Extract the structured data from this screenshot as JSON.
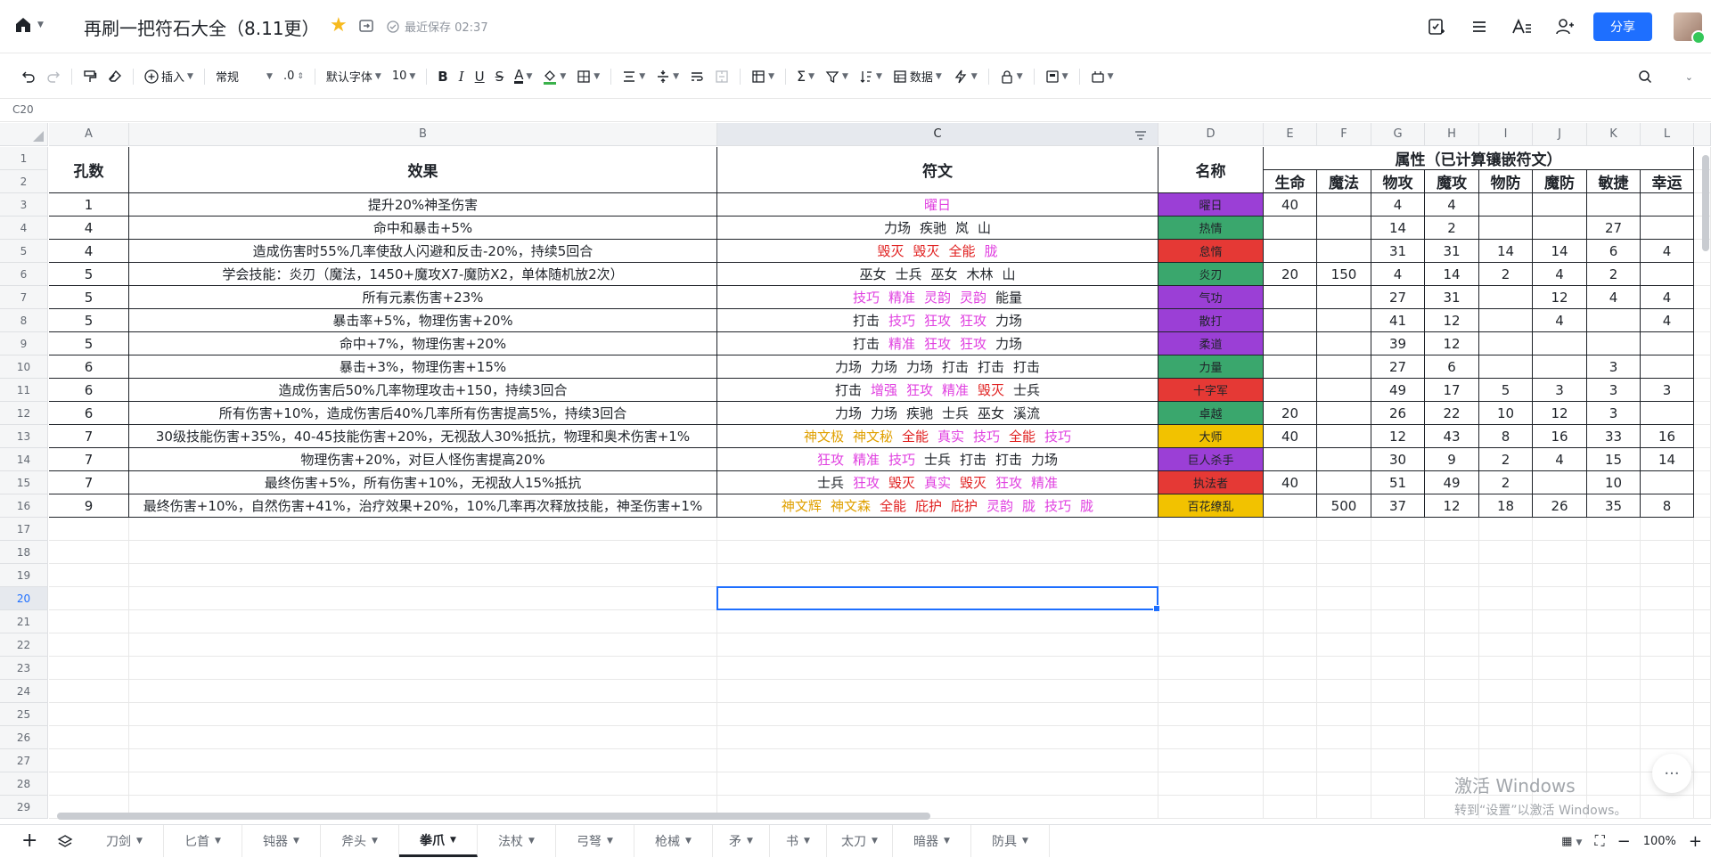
{
  "app": {
    "title": "再刷一把符石大全（8.11更）",
    "save_status": "最近保存 02:37",
    "share_label": "分享"
  },
  "toolbar": {
    "insert_label": "插入",
    "format_label": "常规",
    "decimal_label": ".0",
    "font_label": "默认字体",
    "size_label": "10",
    "data_label": "数据",
    "text_color": "#1f2329",
    "fill_color": "#3ab14b"
  },
  "cell_ref": "C20",
  "columns": [
    "A",
    "B",
    "C",
    "D",
    "E",
    "F",
    "G",
    "H",
    "I",
    "J",
    "K",
    "L"
  ],
  "row_numbers": [
    "1",
    "2",
    "3",
    "4",
    "5",
    "6",
    "7",
    "8",
    "9",
    "10",
    "11",
    "12",
    "13",
    "14",
    "15",
    "16",
    "17",
    "18",
    "19",
    "20",
    "21",
    "22",
    "23",
    "24",
    "25",
    "26",
    "27",
    "28",
    "29"
  ],
  "headers": {
    "holes": "孔数",
    "effect": "效果",
    "runes": "符文",
    "name": "名称",
    "attrs_group": "属性（已计算镶嵌符文）",
    "attrs": [
      "生命",
      "魔法",
      "物攻",
      "魔攻",
      "物防",
      "魔防",
      "敏捷",
      "幸运"
    ]
  },
  "colors": {
    "magenta": "#e040e0",
    "red": "#e02020",
    "gold": "#e0a000",
    "black": "#1f2329",
    "purple": "#9b3fd6",
    "green": "#3aa76d",
    "redfill": "#e53935",
    "yellow": "#f2c200"
  },
  "rows": [
    {
      "holes": "1",
      "effect": "提升20%神圣伤害",
      "runes": [
        {
          "t": "曜日",
          "c": "magenta"
        }
      ],
      "name": "曜日",
      "fill": "purple",
      "stats": [
        "40",
        "",
        "4",
        "4",
        "",
        "",
        "",
        ""
      ]
    },
    {
      "holes": "4",
      "effect": "命中和暴击+5%",
      "runes": [
        {
          "t": "力场",
          "c": "black"
        },
        {
          "t": "疾驰",
          "c": "black"
        },
        {
          "t": "岚",
          "c": "black"
        },
        {
          "t": "山",
          "c": "black"
        }
      ],
      "name": "热情",
      "fill": "green",
      "stats": [
        "",
        "",
        "14",
        "2",
        "",
        "",
        "27",
        ""
      ]
    },
    {
      "holes": "4",
      "effect": "造成伤害时55%几率使敌人闪避和反击-20%，持续5回合",
      "runes": [
        {
          "t": "毁灭",
          "c": "red"
        },
        {
          "t": "毁灭",
          "c": "red"
        },
        {
          "t": "全能",
          "c": "red"
        },
        {
          "t": "胧",
          "c": "magenta"
        }
      ],
      "name": "怠惰",
      "fill": "redfill",
      "stats": [
        "",
        "",
        "31",
        "31",
        "14",
        "14",
        "6",
        "4"
      ]
    },
    {
      "holes": "5",
      "effect": "学会技能：炎刃（魔法，1450+魔攻X7-魔防X2，单体随机放2次）",
      "runes": [
        {
          "t": "巫女",
          "c": "black"
        },
        {
          "t": "士兵",
          "c": "black"
        },
        {
          "t": "巫女",
          "c": "black"
        },
        {
          "t": "木林",
          "c": "black"
        },
        {
          "t": "山",
          "c": "black"
        }
      ],
      "name": "炎刃",
      "fill": "green",
      "stats": [
        "20",
        "150",
        "4",
        "14",
        "2",
        "4",
        "2",
        ""
      ]
    },
    {
      "holes": "5",
      "effect": "所有元素伤害+23%",
      "runes": [
        {
          "t": "技巧",
          "c": "magenta"
        },
        {
          "t": "精准",
          "c": "magenta"
        },
        {
          "t": "灵韵",
          "c": "magenta"
        },
        {
          "t": "灵韵",
          "c": "magenta"
        },
        {
          "t": "能量",
          "c": "black"
        }
      ],
      "name": "气功",
      "fill": "purple",
      "stats": [
        "",
        "",
        "27",
        "31",
        "",
        "12",
        "4",
        "4"
      ]
    },
    {
      "holes": "5",
      "effect": "暴击率+5%，物理伤害+20%",
      "runes": [
        {
          "t": "打击",
          "c": "black"
        },
        {
          "t": "技巧",
          "c": "magenta"
        },
        {
          "t": "狂攻",
          "c": "magenta"
        },
        {
          "t": "狂攻",
          "c": "magenta"
        },
        {
          "t": "力场",
          "c": "black"
        }
      ],
      "name": "散打",
      "fill": "purple",
      "stats": [
        "",
        "",
        "41",
        "12",
        "",
        "4",
        "",
        "4"
      ]
    },
    {
      "holes": "5",
      "effect": "命中+7%，物理伤害+20%",
      "runes": [
        {
          "t": "打击",
          "c": "black"
        },
        {
          "t": "精准",
          "c": "magenta"
        },
        {
          "t": "狂攻",
          "c": "magenta"
        },
        {
          "t": "狂攻",
          "c": "magenta"
        },
        {
          "t": "力场",
          "c": "black"
        }
      ],
      "name": "柔道",
      "fill": "purple",
      "stats": [
        "",
        "",
        "39",
        "12",
        "",
        "",
        "",
        ""
      ]
    },
    {
      "holes": "6",
      "effect": "暴击+3%，物理伤害+15%",
      "runes": [
        {
          "t": "力场",
          "c": "black"
        },
        {
          "t": "力场",
          "c": "black"
        },
        {
          "t": "力场",
          "c": "black"
        },
        {
          "t": "打击",
          "c": "black"
        },
        {
          "t": "打击",
          "c": "black"
        },
        {
          "t": "打击",
          "c": "black"
        }
      ],
      "name": "力量",
      "fill": "green",
      "stats": [
        "",
        "",
        "27",
        "6",
        "",
        "",
        "3",
        ""
      ]
    },
    {
      "holes": "6",
      "effect": "造成伤害后50%几率物理攻击+150，持续3回合",
      "runes": [
        {
          "t": "打击",
          "c": "black"
        },
        {
          "t": "增强",
          "c": "magenta"
        },
        {
          "t": "狂攻",
          "c": "magenta"
        },
        {
          "t": "精准",
          "c": "magenta"
        },
        {
          "t": "毁灭",
          "c": "red"
        },
        {
          "t": "士兵",
          "c": "black"
        }
      ],
      "name": "十字军",
      "fill": "redfill",
      "stats": [
        "",
        "",
        "49",
        "17",
        "5",
        "3",
        "3",
        "3"
      ]
    },
    {
      "holes": "6",
      "effect": "所有伤害+10%，造成伤害后40%几率所有伤害提高5%，持续3回合",
      "runes": [
        {
          "t": "力场",
          "c": "black"
        },
        {
          "t": "力场",
          "c": "black"
        },
        {
          "t": "疾驰",
          "c": "black"
        },
        {
          "t": "士兵",
          "c": "black"
        },
        {
          "t": "巫女",
          "c": "black"
        },
        {
          "t": "溪流",
          "c": "black"
        }
      ],
      "name": "卓越",
      "fill": "green",
      "stats": [
        "20",
        "",
        "26",
        "22",
        "10",
        "12",
        "3",
        ""
      ]
    },
    {
      "holes": "7",
      "effect": "30级技能伤害+35%，40-45技能伤害+20%，无视敌人30%抵抗，物理和奥术伤害+1%",
      "runes": [
        {
          "t": "神文极",
          "c": "gold"
        },
        {
          "t": "神文秘",
          "c": "gold"
        },
        {
          "t": "全能",
          "c": "red"
        },
        {
          "t": "真实",
          "c": "magenta"
        },
        {
          "t": "技巧",
          "c": "magenta"
        },
        {
          "t": "全能",
          "c": "red"
        },
        {
          "t": "技巧",
          "c": "magenta"
        }
      ],
      "name": "大师",
      "fill": "yellow",
      "stats": [
        "40",
        "",
        "12",
        "43",
        "8",
        "16",
        "33",
        "16"
      ]
    },
    {
      "holes": "7",
      "effect": "物理伤害+20%，对巨人怪伤害提高20%",
      "runes": [
        {
          "t": "狂攻",
          "c": "magenta"
        },
        {
          "t": "精准",
          "c": "magenta"
        },
        {
          "t": "技巧",
          "c": "magenta"
        },
        {
          "t": "士兵",
          "c": "black"
        },
        {
          "t": "打击",
          "c": "black"
        },
        {
          "t": "打击",
          "c": "black"
        },
        {
          "t": "力场",
          "c": "black"
        }
      ],
      "name": "巨人杀手",
      "fill": "purple",
      "stats": [
        "",
        "",
        "30",
        "9",
        "2",
        "4",
        "15",
        "14"
      ]
    },
    {
      "holes": "7",
      "effect": "最终伤害+5%，所有伤害+10%，无视敌人15%抵抗",
      "runes": [
        {
          "t": "士兵",
          "c": "black"
        },
        {
          "t": "狂攻",
          "c": "magenta"
        },
        {
          "t": "毁灭",
          "c": "red"
        },
        {
          "t": "真实",
          "c": "magenta"
        },
        {
          "t": "毁灭",
          "c": "red"
        },
        {
          "t": "狂攻",
          "c": "magenta"
        },
        {
          "t": "精准",
          "c": "magenta"
        }
      ],
      "name": "执法者",
      "fill": "redfill",
      "stats": [
        "40",
        "",
        "51",
        "49",
        "2",
        "",
        "10",
        ""
      ]
    },
    {
      "holes": "9",
      "effect": "最终伤害+10%，自然伤害+41%，治疗效果+20%，10%几率再次释放技能，神圣伤害+1%",
      "runes": [
        {
          "t": "神文辉",
          "c": "gold"
        },
        {
          "t": "神文森",
          "c": "gold"
        },
        {
          "t": "全能",
          "c": "red"
        },
        {
          "t": "庇护",
          "c": "red"
        },
        {
          "t": "庇护",
          "c": "red"
        },
        {
          "t": "灵韵",
          "c": "magenta"
        },
        {
          "t": "胧",
          "c": "magenta"
        },
        {
          "t": "技巧",
          "c": "magenta"
        },
        {
          "t": "胧",
          "c": "magenta"
        }
      ],
      "name": "百花缭乱",
      "fill": "yellow",
      "stats": [
        "",
        "500",
        "37",
        "12",
        "18",
        "26",
        "35",
        "8"
      ]
    }
  ],
  "watermark": {
    "line1": "激活 Windows",
    "line2": "转到“设置”以激活 Windows。"
  },
  "sheet_tabs": [
    "刀剑",
    "匕首",
    "钝器",
    "斧头",
    "拳爪",
    "法杖",
    "弓弩",
    "枪械",
    "矛",
    "书",
    "太刀",
    "暗器",
    "防具"
  ],
  "active_tab": "拳爪",
  "zoom": "100%"
}
